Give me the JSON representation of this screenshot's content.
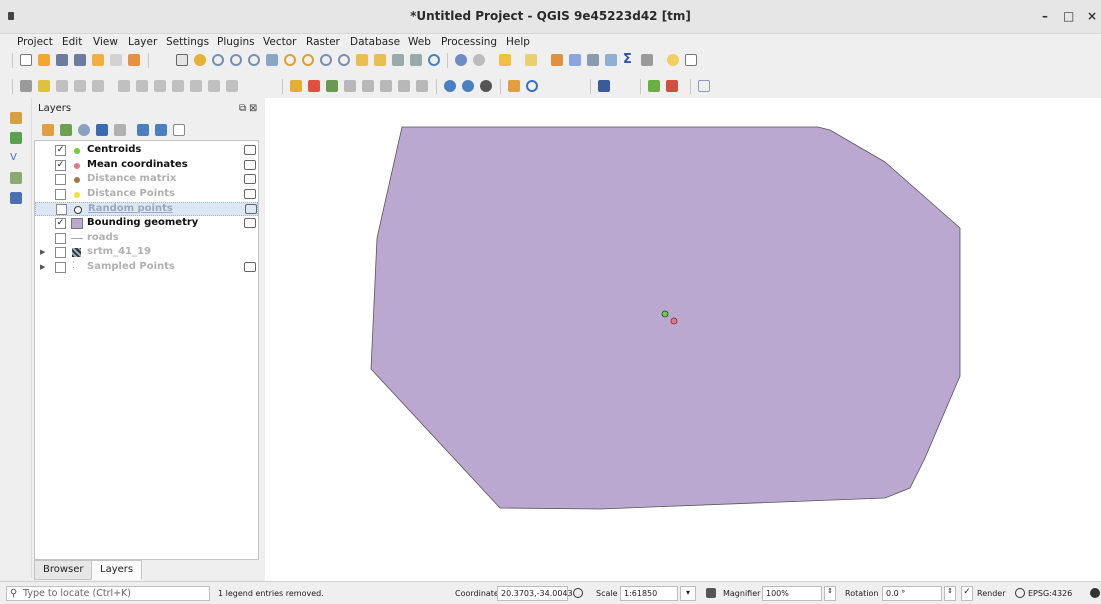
{
  "window": {
    "title": "*Untitled Project - QGIS 9e45223d42 [tm]",
    "minimize_glyph": "–",
    "maximize_glyph": "□",
    "close_glyph": "×"
  },
  "menubar": [
    "Project",
    "Edit",
    "View",
    "Layer",
    "Settings",
    "Plugins",
    "Vector",
    "Raster",
    "Database",
    "Web",
    "Processing",
    "Help"
  ],
  "layers_panel": {
    "title": "Layers",
    "float_glyph": "⧉",
    "close_glyph": "⊠",
    "layers": [
      {
        "name": "Centroids",
        "checked": true,
        "symbol": "point",
        "color": "#6ad13a",
        "state": "on",
        "has_count": true
      },
      {
        "name": "Mean coordinates",
        "checked": true,
        "symbol": "point",
        "color": "#e07a80",
        "state": "on",
        "has_count": true
      },
      {
        "name": "Distance matrix",
        "checked": false,
        "symbol": "point",
        "color": "#a07840",
        "state": "off",
        "has_count": true
      },
      {
        "name": "Distance Points",
        "checked": false,
        "symbol": "point",
        "color": "#f2e03c",
        "state": "off",
        "has_count": true
      },
      {
        "name": "Random points",
        "checked": false,
        "symbol": "circle",
        "color": "#ffffff",
        "state": "selected",
        "has_count": true
      },
      {
        "name": "Bounding geometry",
        "checked": true,
        "symbol": "polygon",
        "color": "#bba8d1",
        "state": "on",
        "has_count": true
      },
      {
        "name": "roads",
        "checked": false,
        "symbol": "line",
        "color": "#aaaaaa",
        "state": "off",
        "has_count": false
      },
      {
        "name": "srtm_41_19",
        "checked": false,
        "symbol": "raster",
        "color": "#333333",
        "state": "off",
        "has_count": false,
        "expandable": true
      },
      {
        "name": "Sampled Points",
        "checked": false,
        "symbol": "dots",
        "color": "#999999",
        "state": "off",
        "has_count": true,
        "expandable": true
      }
    ],
    "tabs": [
      "Browser",
      "Layers"
    ],
    "active_tab": "Layers"
  },
  "map": {
    "polygon_fill": "#bba8d1",
    "polygon_stroke": "#555555",
    "centroid_color": "#6ad13a",
    "mean_color": "#e07a80"
  },
  "statusbar": {
    "locator_placeholder": "Type to locate (Ctrl+K)",
    "message": "1 legend entries removed.",
    "coordinate_label": "Coordinate",
    "coordinate_value": "20.3703,-34.0043",
    "scale_label": "Scale",
    "scale_value": "1:61850",
    "magnifier_label": "Magnifier",
    "magnifier_value": "100%",
    "rotation_label": "Rotation",
    "rotation_value": "0.0 °",
    "render_label": "Render",
    "render_checked": true,
    "crs": "EPSG:4326"
  }
}
